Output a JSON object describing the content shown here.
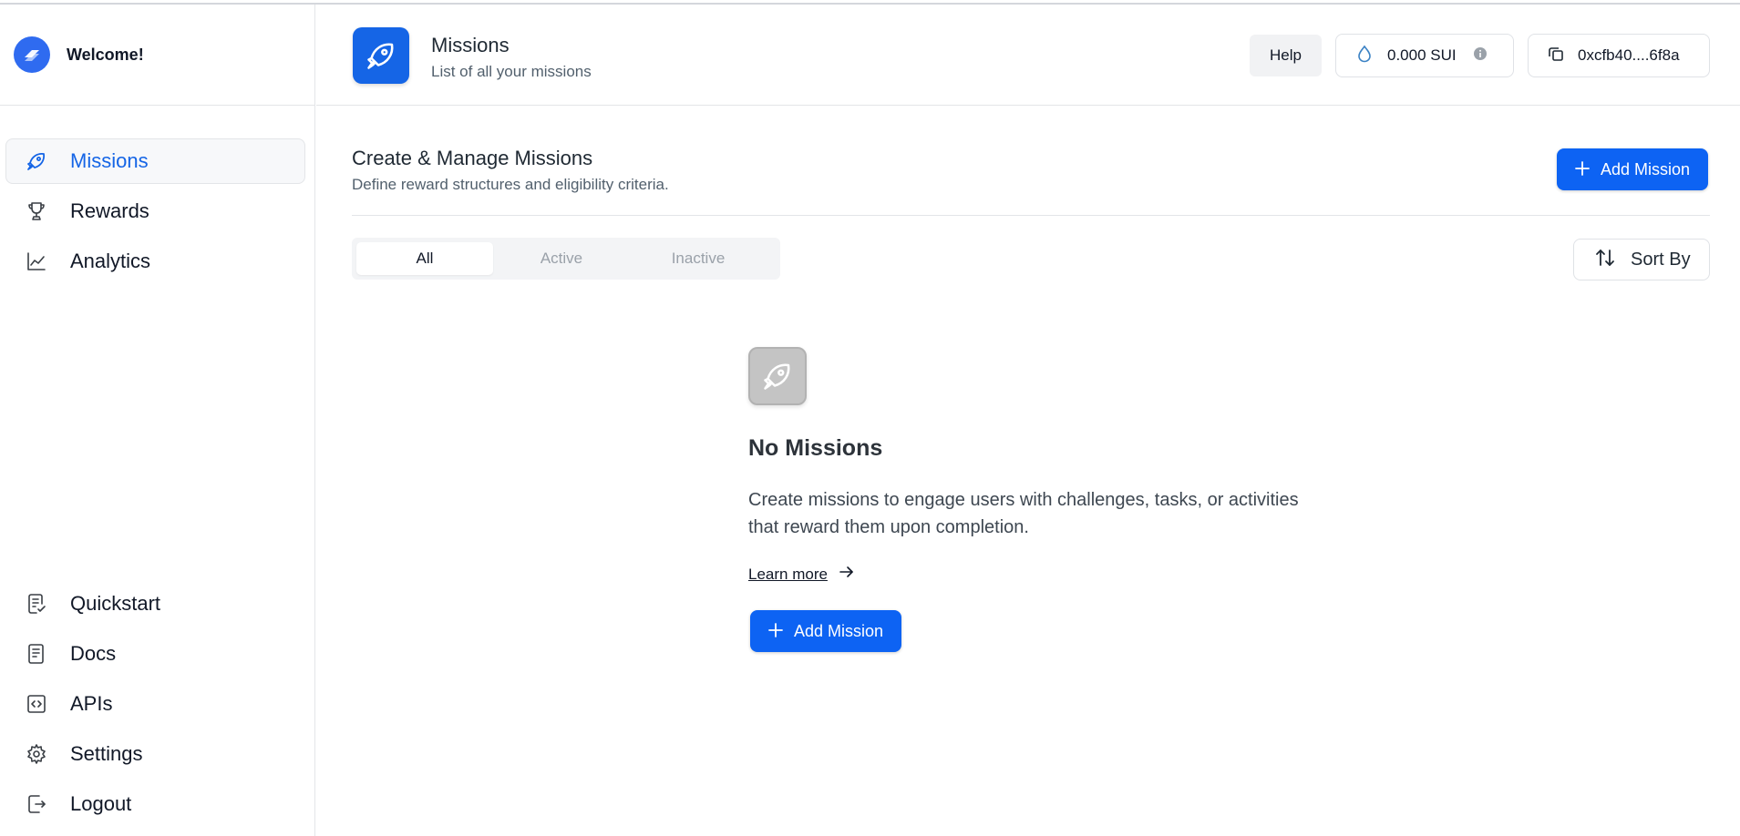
{
  "brand": {
    "title": "Welcome!"
  },
  "sidebar": {
    "top_items": [
      {
        "label": "Missions",
        "icon": "rocket-icon",
        "active": true
      },
      {
        "label": "Rewards",
        "icon": "trophy-icon"
      },
      {
        "label": "Analytics",
        "icon": "chart-line-icon"
      }
    ],
    "bottom_items": [
      {
        "label": "Quickstart",
        "icon": "checklist-icon"
      },
      {
        "label": "Docs",
        "icon": "document-icon"
      },
      {
        "label": "APIs",
        "icon": "code-icon"
      },
      {
        "label": "Settings",
        "icon": "gear-icon"
      },
      {
        "label": "Logout",
        "icon": "logout-icon"
      }
    ]
  },
  "header": {
    "title": "Missions",
    "subtitle": "List of all your missions",
    "help_label": "Help",
    "balance": "0.000 SUI",
    "wallet": "0xcfb40....6f8a"
  },
  "main": {
    "section_title": "Create & Manage Missions",
    "section_subtitle": "Define reward structures and eligibility criteria.",
    "add_label": "Add Mission",
    "tabs": [
      {
        "label": "All",
        "active": true
      },
      {
        "label": "Active"
      },
      {
        "label": "Inactive"
      }
    ],
    "sort_label": "Sort By"
  },
  "empty_state": {
    "title": "No Missions",
    "description": "Create missions to engage users with challenges, tasks, or activities that reward them upon completion.",
    "learn_more": "Learn more",
    "add_label": "Add Mission"
  },
  "colors": {
    "accent": "#0d63f3",
    "active_nav_text": "#1565e6",
    "muted_icon": "#c4c4c4"
  }
}
